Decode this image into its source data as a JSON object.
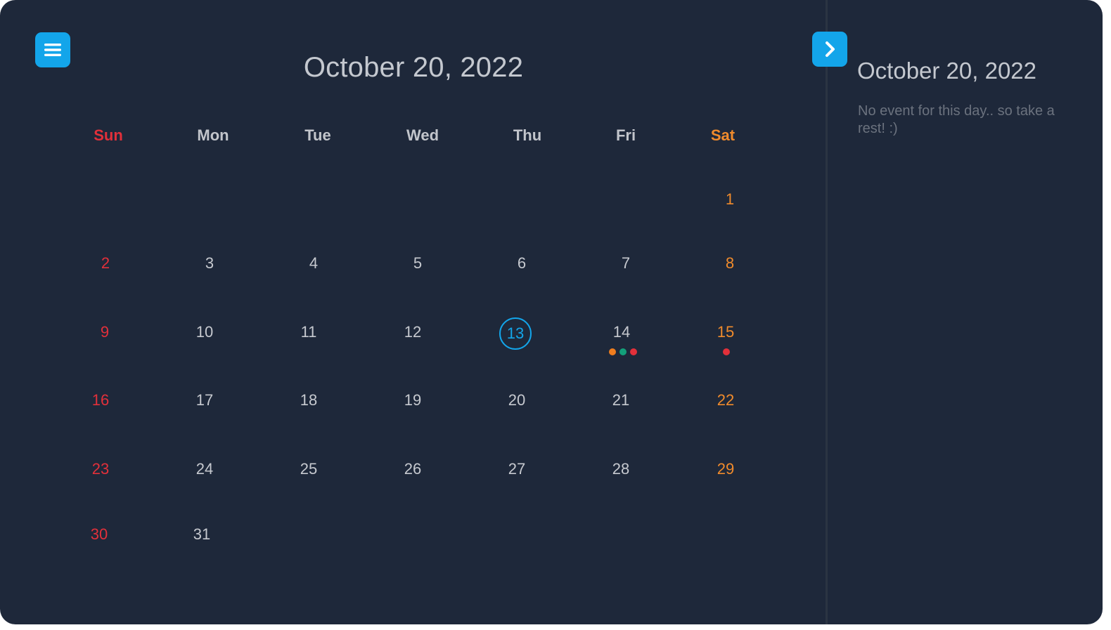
{
  "calendar": {
    "title": "October 20, 2022",
    "weekdays": [
      "Sun",
      "Mon",
      "Tue",
      "Wed",
      "Thu",
      "Fri",
      "Sat"
    ],
    "days": {
      "d1": "1",
      "d2": "2",
      "d3": "3",
      "d4": "4",
      "d5": "5",
      "d6": "6",
      "d7": "7",
      "d8": "8",
      "d9": "9",
      "d10": "10",
      "d11": "11",
      "d12": "12",
      "d13": "13",
      "d14": "14",
      "d15": "15",
      "d16": "16",
      "d17": "17",
      "d18": "18",
      "d19": "19",
      "d20": "20",
      "d21": "21",
      "d22": "22",
      "d23": "23",
      "d24": "24",
      "d25": "25",
      "d26": "26",
      "d27": "27",
      "d28": "28",
      "d29": "29",
      "d30": "30",
      "d31": "31"
    },
    "highlighted_day": "13",
    "event_markers": {
      "14": [
        "#ef7d1e",
        "#13a07a",
        "#e2303a"
      ],
      "15": [
        "#e2303a"
      ]
    }
  },
  "side_panel": {
    "title": "October 20, 2022",
    "empty_message": "No event for this day.. so take a rest! :)"
  },
  "colors": {
    "background": "#1e283a",
    "accent": "#13a5ea",
    "sunday": "#e2303a",
    "saturday": "#f08b2c",
    "text": "#c6c9cf",
    "muted": "#6b727e"
  },
  "icons": {
    "menu": "hamburger-menu-icon",
    "next": "chevron-right-icon"
  }
}
